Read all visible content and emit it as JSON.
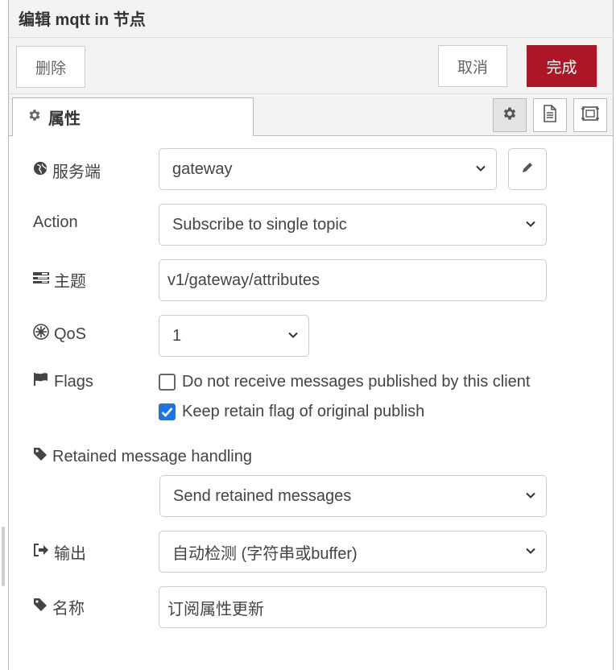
{
  "dialog": {
    "title": "编辑 mqtt in 节点"
  },
  "toolbar": {
    "delete_label": "删除",
    "cancel_label": "取消",
    "done_label": "完成"
  },
  "tabs": {
    "active_label": "属性",
    "icons": [
      "gear-icon",
      "document-icon",
      "layout-icon"
    ]
  },
  "form": {
    "server": {
      "label": "服务端",
      "value": "gateway"
    },
    "action": {
      "label": "Action",
      "value": "Subscribe to single topic"
    },
    "topic": {
      "label": "主题",
      "value": "v1/gateway/attributes"
    },
    "qos": {
      "label": "QoS",
      "value": "1"
    },
    "flags": {
      "label": "Flags",
      "options": [
        {
          "label": "Do not receive messages published by this client",
          "checked": false
        },
        {
          "label": "Keep retain flag of original publish",
          "checked": true
        }
      ]
    },
    "retained": {
      "label": "Retained message handling",
      "value": "Send retained messages"
    },
    "output": {
      "label": "输出",
      "value": "自动检测 (字符串或buffer)"
    },
    "name": {
      "label": "名称",
      "value": "订阅属性更新"
    }
  },
  "colors": {
    "primary_button": "#ad1625",
    "checkbox_checked": "#1a73e8",
    "panel_background": "#f3f3f3"
  }
}
